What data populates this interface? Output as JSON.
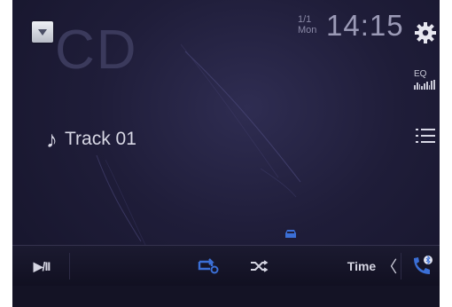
{
  "source": {
    "label": "CD",
    "menu_icon": "chevron-down-icon"
  },
  "clock": {
    "date_top": "1/1",
    "date_bottom": "Mon",
    "time": "14:15"
  },
  "top_right": {
    "settings_icon": "gear-icon",
    "eq_label": "EQ",
    "eq_icon": "equalizer-icon",
    "list_icon": "list-icon"
  },
  "track": {
    "note_icon": "♪",
    "name": "Track 01"
  },
  "bottom_bar": {
    "play_pause": "▶/II",
    "repeat_icon": "repeat-icon",
    "shuffle_icon": "shuffle-icon",
    "time_label": "Time",
    "chevron": "〈",
    "phone_icon": "bluetooth-phone-icon"
  },
  "colors": {
    "accent": "#3b6fd6",
    "background": "#1f1d39",
    "text": "#d7d7e4"
  }
}
